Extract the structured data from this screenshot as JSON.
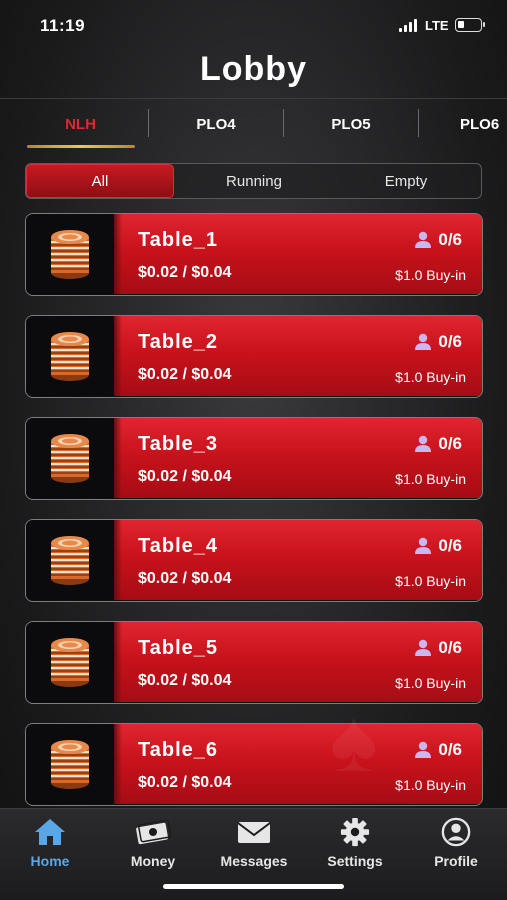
{
  "status": {
    "time": "11:19",
    "network": "LTE"
  },
  "header": {
    "title": "Lobby"
  },
  "game_tabs": [
    "NLH",
    "PLO4",
    "PLO5",
    "PLO6"
  ],
  "active_game_tab": "NLH",
  "filters": [
    "All",
    "Running",
    "Empty"
  ],
  "active_filter": "All",
  "tables": [
    {
      "name": "Table_1",
      "players": "0/6",
      "stakes": "$0.02 / $0.04",
      "buyin": "$1.0 Buy-in"
    },
    {
      "name": "Table_2",
      "players": "0/6",
      "stakes": "$0.02 / $0.04",
      "buyin": "$1.0 Buy-in"
    },
    {
      "name": "Table_3",
      "players": "0/6",
      "stakes": "$0.02 / $0.04",
      "buyin": "$1.0 Buy-in"
    },
    {
      "name": "Table_4",
      "players": "0/6",
      "stakes": "$0.02 / $0.04",
      "buyin": "$1.0 Buy-in"
    },
    {
      "name": "Table_5",
      "players": "0/6",
      "stakes": "$0.02 / $0.04",
      "buyin": "$1.0 Buy-in"
    },
    {
      "name": "Table_6",
      "players": "0/6",
      "stakes": "$0.02 / $0.04",
      "buyin": "$1.0 Buy-in"
    }
  ],
  "nav": {
    "home": "Home",
    "money": "Money",
    "messages": "Messages",
    "settings": "Settings",
    "profile": "Profile"
  },
  "colors": {
    "accent_red": "#e3262f",
    "card_red": "#c8121c",
    "active_nav_blue": "#5aa7e8",
    "tab_underline_gold": "#f2c451"
  },
  "icons": {
    "chip_stack": "chip-stack-icon",
    "player": "person-icon",
    "home": "home-icon",
    "money": "money-icon",
    "messages": "envelope-icon",
    "settings": "gear-icon",
    "profile": "profile-icon"
  }
}
